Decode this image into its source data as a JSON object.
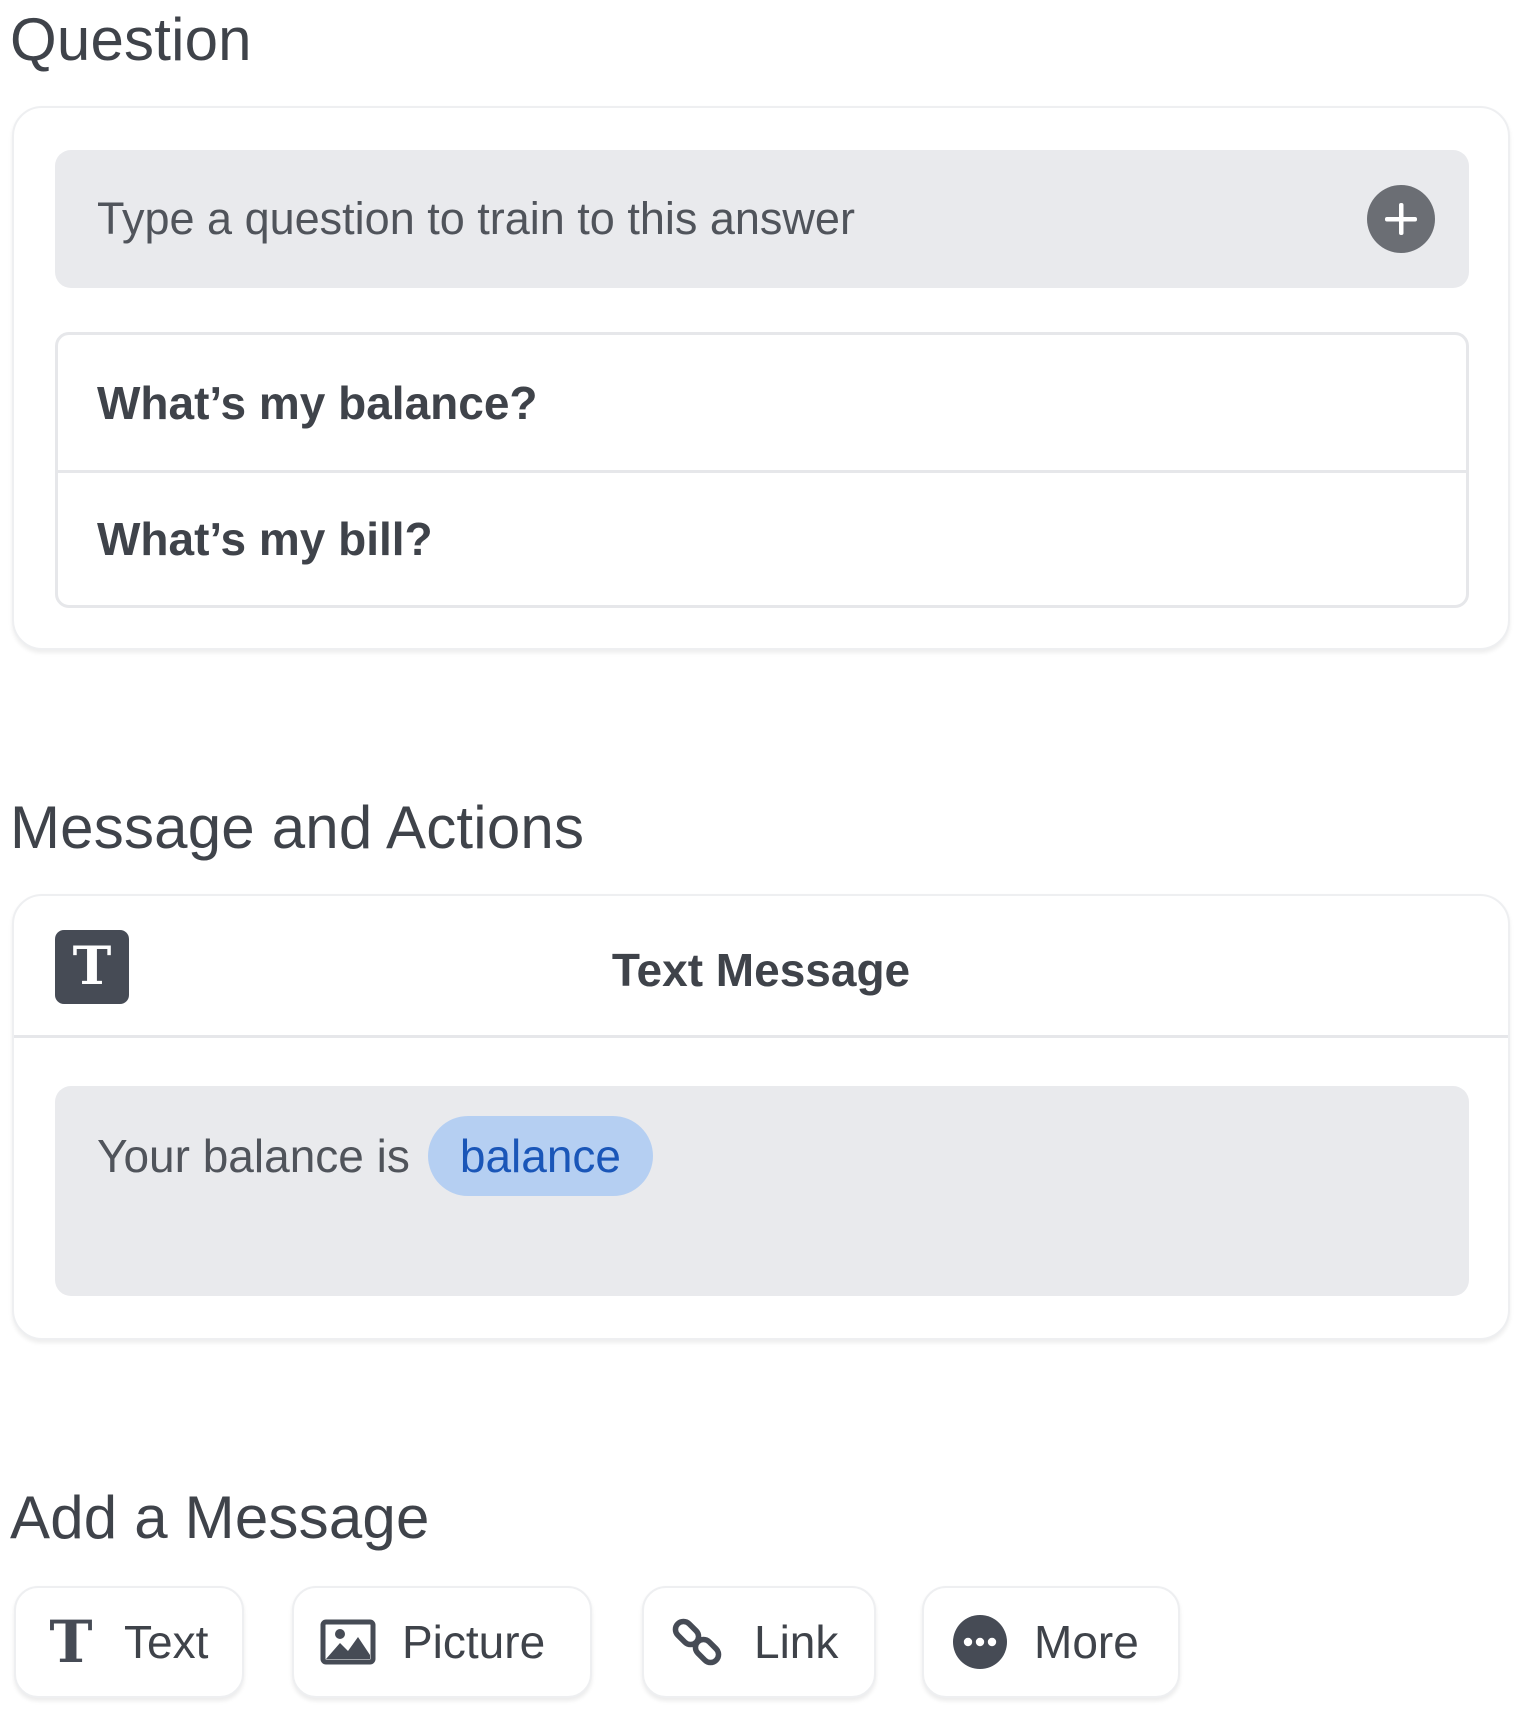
{
  "question_section": {
    "title": "Question",
    "input_placeholder": "Type a question to train to this answer",
    "add_icon": "plus-circle-icon",
    "questions": [
      "What’s my balance?",
      "What’s my bill?"
    ]
  },
  "message_section": {
    "title": "Message and Actions",
    "card_icon": "text-t-icon",
    "card_icon_letter": "T",
    "card_title": "Text Message",
    "message_text": "Your balance is",
    "variable": "balance"
  },
  "add_message_section": {
    "title": "Add a Message",
    "buttons": [
      {
        "label": "Text",
        "icon": "text-t-icon",
        "icon_letter": "T"
      },
      {
        "label": "Picture",
        "icon": "picture-icon"
      },
      {
        "label": "Link",
        "icon": "link-chain-icon"
      },
      {
        "label": "More",
        "icon": "more-ellipsis-icon"
      }
    ]
  },
  "colors": {
    "text": "#3f434a",
    "input_bg": "#e9eaed",
    "chip_bg": "#b5cff2",
    "chip_text": "#1a56b8",
    "icon_dark": "#464b55",
    "add_icon_bg": "#6b6e74"
  }
}
